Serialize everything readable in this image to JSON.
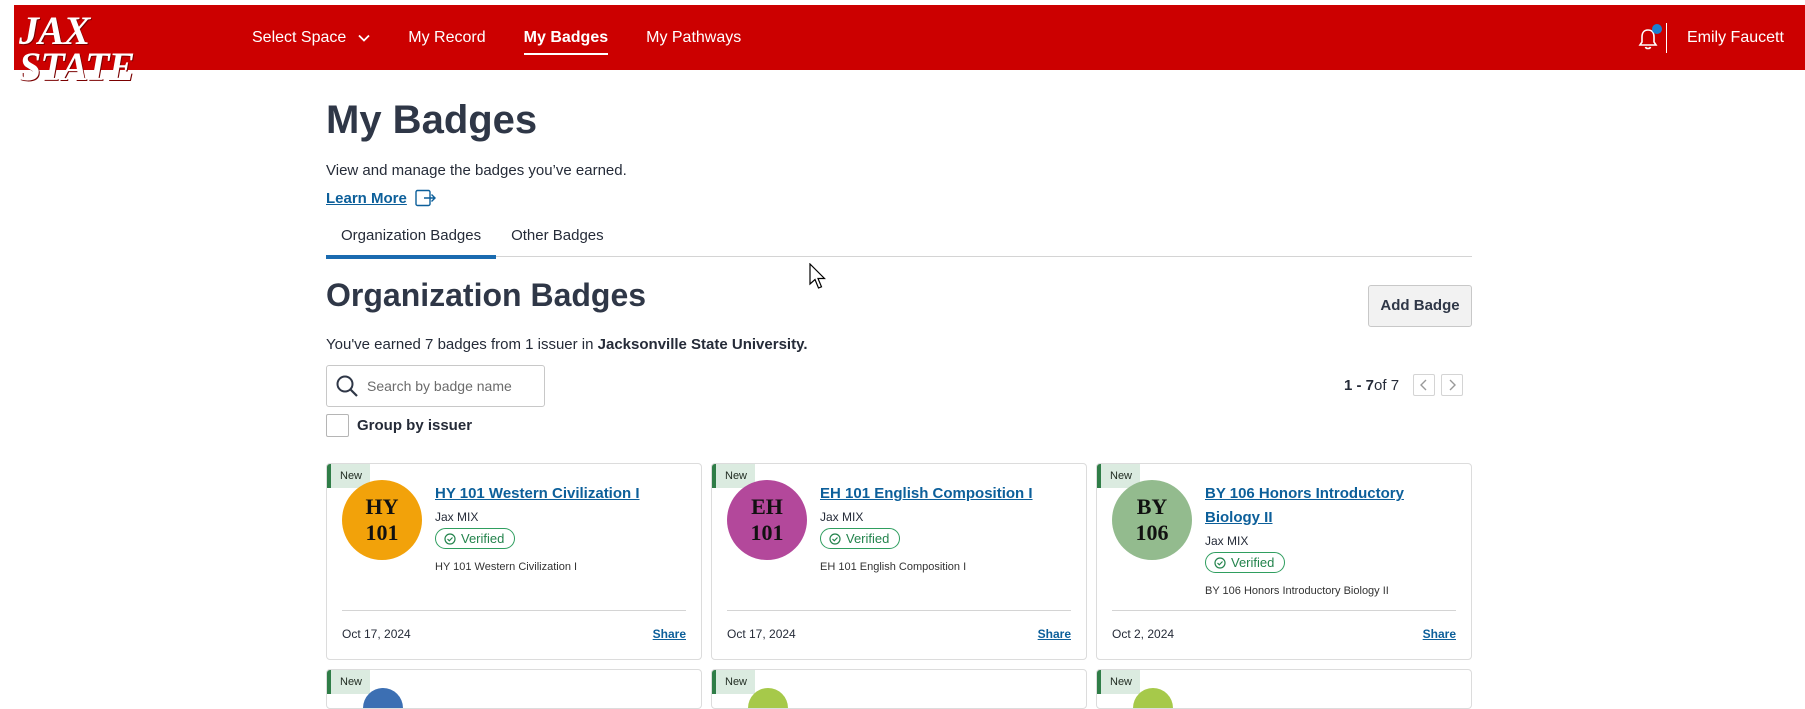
{
  "header": {
    "logo_main": "JAX STATE",
    "logo_sub": "Jacksonville State University.",
    "nav": [
      {
        "label": "Select Space"
      },
      {
        "label": "My Record"
      },
      {
        "label": "My Badges"
      },
      {
        "label": "My Pathways"
      }
    ],
    "user_name": "Emily Faucett"
  },
  "page": {
    "title": "My Badges",
    "description": "View and manage the badges you’ve earned.",
    "learn_more": "Learn More",
    "tabs": [
      "Organization Badges",
      "Other Badges"
    ],
    "active_tab": "Organization Badges"
  },
  "section": {
    "title": "Organization Badges",
    "add_badge": "Add Badge",
    "earned_prefix": "You've earned 7 badges from 1 issuer in ",
    "earned_org": "Jacksonville State University.",
    "search_placeholder": "Search by badge name",
    "pager_range": "1 - 7",
    "pager_total": " of 7",
    "group_by": "Group by issuer"
  },
  "badges": [
    {
      "new_label": "New",
      "code1": "HY",
      "code2": "101",
      "color": "#f2a20a",
      "title": "HY 101 Western Civilization I",
      "issuer": "Jax MIX",
      "verified": "Verified",
      "desc": "HY 101 Western Civilization I",
      "date": "Oct 17, 2024",
      "share": "Share"
    },
    {
      "new_label": "New",
      "code1": "EH",
      "code2": "101",
      "color": "#b3489b",
      "title": "EH 101 English Composition I",
      "issuer": "Jax MIX",
      "verified": "Verified",
      "desc": "EH 101 English Composition I",
      "date": "Oct 17, 2024",
      "share": "Share"
    },
    {
      "new_label": "New",
      "code1": "BY",
      "code2": "106",
      "color": "#93bb8e",
      "title": "BY 106 Honors Introductory Biology II",
      "issuer": "Jax MIX",
      "verified": "Verified",
      "desc": "BY 106 Honors Introductory Biology II",
      "date": "Oct 2, 2024",
      "share": "Share"
    }
  ],
  "row2_new_labels": [
    "New",
    "New",
    "New"
  ]
}
